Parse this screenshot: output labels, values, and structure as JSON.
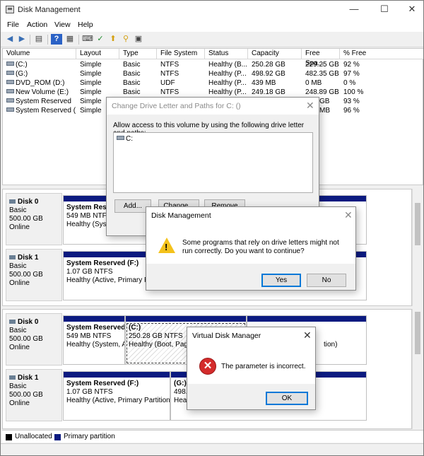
{
  "window": {
    "title": "Disk Management",
    "controls": {
      "minimize": "—",
      "maximize": "☐",
      "close": "✕"
    }
  },
  "menu": [
    "File",
    "Action",
    "View",
    "Help"
  ],
  "toolbar_icons": [
    "back-arrow-icon",
    "forward-arrow-icon",
    "console-tree-icon",
    "help-icon",
    "properties-icon",
    "refresh-icon",
    "check-icon",
    "export-icon",
    "search-icon",
    "settings-icon"
  ],
  "volume_table": {
    "headers": [
      "Volume",
      "Layout",
      "Type",
      "File System",
      "Status",
      "Capacity",
      "Free Spa...",
      "% Free"
    ],
    "rows": [
      [
        "(C:)",
        "Simple",
        "Basic",
        "NTFS",
        "Healthy (B...",
        "250.28 GB",
        "229.25 GB",
        "92 %"
      ],
      [
        "(G:)",
        "Simple",
        "Basic",
        "NTFS",
        "Healthy (P...",
        "498.92 GB",
        "482.35 GB",
        "97 %"
      ],
      [
        "DVD_ROM (D:)",
        "Simple",
        "Basic",
        "UDF",
        "Healthy (P...",
        "439 MB",
        "0 MB",
        "0 %"
      ],
      [
        "New Volume (E:)",
        "Simple",
        "Basic",
        "NTFS",
        "Healthy (P...",
        "249.18 GB",
        "248.89 GB",
        "100 %"
      ],
      [
        "System Reserved",
        "Simple",
        "",
        "",
        "",
        "",
        "GB",
        "93 %"
      ],
      [
        "System Reserved (...",
        "Simple",
        "",
        "",
        "",
        "",
        "MB",
        "96 %"
      ]
    ]
  },
  "disks_top": [
    {
      "name": "Disk 0",
      "type": "Basic",
      "size": "500.00 GB",
      "status": "Online",
      "partition": {
        "name": "System Reserved",
        "line2": "549 MB NTFS",
        "line3": "Healthy (Syster"
      }
    },
    {
      "name": "Disk 1",
      "type": "Basic",
      "size": "500.00 GB",
      "status": "Online",
      "partition": {
        "name": "System Reserved  (F:)",
        "line2": "1.07 GB NTFS",
        "line3": "Healthy (Active, Primary Partitio"
      }
    }
  ],
  "disks_bottom": [
    {
      "name": "Disk 0",
      "type": "Basic",
      "size": "500.00 GB",
      "status": "Online",
      "p1": {
        "name": "System Reserved",
        "line2": "549 MB NTFS",
        "line3": "Healthy (System, A"
      },
      "p2": {
        "name": "(C:)",
        "line2": "250.28 GB NTFS",
        "line3": "Healthy (Boot, Page"
      },
      "p3": {
        "line3": "tion)"
      }
    },
    {
      "name": "Disk 1",
      "type": "Basic",
      "size": "500.00 GB",
      "status": "Online",
      "p1": {
        "name": "System Reserved  (F:)",
        "line2": "1.07 GB NTFS",
        "line3": "Healthy (Active, Primary Partition"
      },
      "p2": {
        "name": "(G:)",
        "line2": "498.9",
        "line3": "Healt"
      }
    }
  ],
  "legend": [
    {
      "label": "Unallocated",
      "color": "#000000"
    },
    {
      "label": "Primary partition",
      "color": "#0b1a80"
    }
  ],
  "dialog_change_letter": {
    "title": "Change Drive Letter and Paths for C: ()",
    "description": "Allow access to this volume by using the following drive letter and paths:",
    "list_item": "C:",
    "buttons": {
      "add": "Add...",
      "change": "Change...",
      "remove": "Remove"
    }
  },
  "dialog_confirm": {
    "title": "Disk Management",
    "message": "Some programs that rely on drive letters might not run correctly. Do you want to continue?",
    "buttons": {
      "yes": "Yes",
      "no": "No"
    }
  },
  "dialog_error": {
    "title": "Virtual Disk Manager",
    "message": "The parameter is incorrect.",
    "buttons": {
      "ok": "OK"
    }
  }
}
